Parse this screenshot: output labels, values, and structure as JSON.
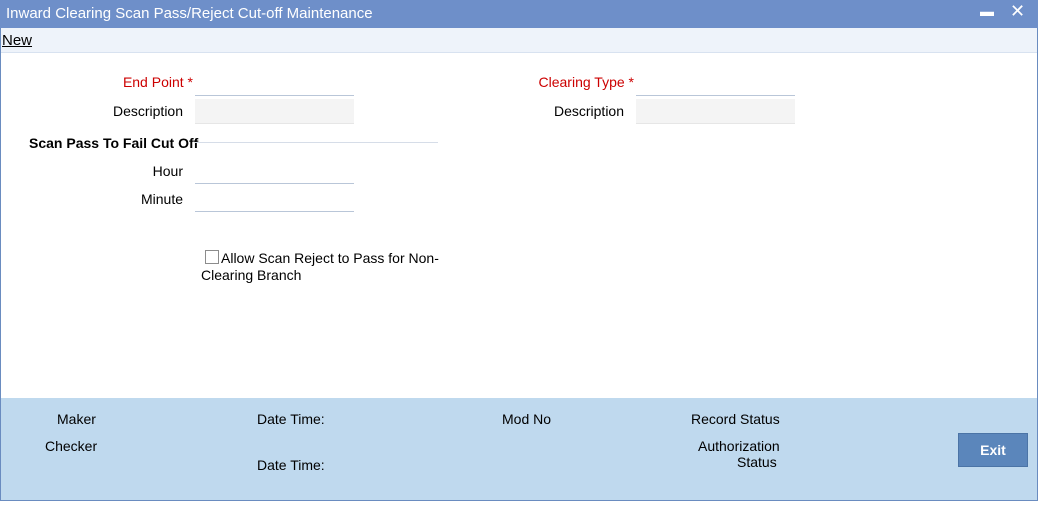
{
  "window": {
    "title": "Inward Clearing Scan Pass/Reject Cut-off Maintenance",
    "minimize_label": "▬",
    "close_label": "✕"
  },
  "menu": {
    "new_label": "New"
  },
  "form": {
    "end_point_label": "End Point",
    "required_mark": "*",
    "description_label": "Description",
    "clearing_type_label": "Clearing Type",
    "description2_label": "Description",
    "section_title": "Scan Pass To Fail Cut Off",
    "hour_label": "Hour",
    "minute_label": "Minute",
    "checkbox_label": "Allow Scan Reject to Pass for Non-Clearing Branch",
    "end_point_value": "",
    "description_value": "",
    "clearing_type_value": "",
    "description2_value": "",
    "hour_value": "",
    "minute_value": "",
    "allow_scan_reject_checked": false
  },
  "footer": {
    "maker_label": "Maker",
    "checker_label": "Checker",
    "date_time_label_1": "Date Time:",
    "date_time_label_2": "Date Time:",
    "mod_no_label": "Mod No",
    "record_status_label": "Record Status",
    "authorization_status_label_1": "Authorization",
    "authorization_status_label_2": "Status",
    "exit_label": "Exit"
  },
  "colors": {
    "titlebar": "#6e8fc9",
    "footer": "#bfd9ee",
    "exit_button": "#5b86bb",
    "required": "#cc0000"
  }
}
